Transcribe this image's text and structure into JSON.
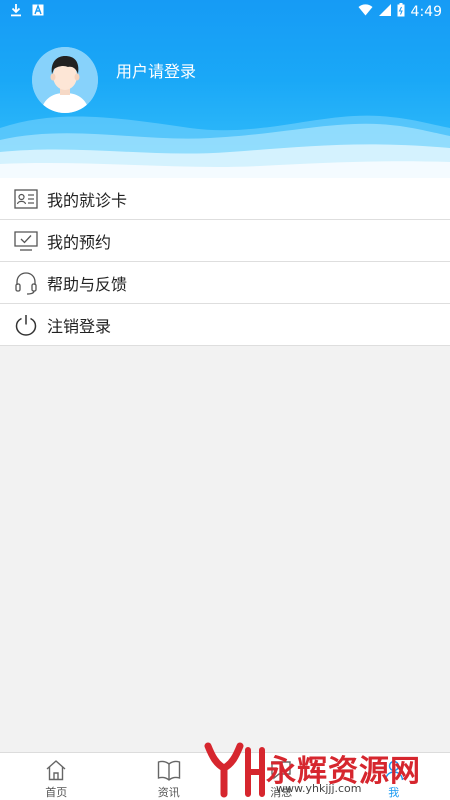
{
  "status_bar": {
    "time": "4:49",
    "icons": [
      "download-icon",
      "a-icon",
      "wifi-icon",
      "signal-icon",
      "battery-icon"
    ]
  },
  "profile": {
    "login_prompt": "用户请登录"
  },
  "menu": {
    "items": [
      {
        "label": "我的就诊卡",
        "icon": "id-card-icon"
      },
      {
        "label": "我的预约",
        "icon": "monitor-check-icon"
      },
      {
        "label": "帮助与反馈",
        "icon": "headset-icon"
      },
      {
        "label": "注销登录",
        "icon": "power-icon"
      }
    ]
  },
  "bottom_nav": {
    "items": [
      {
        "label": "首页",
        "icon": "home-icon"
      },
      {
        "label": "资讯",
        "icon": "book-icon"
      },
      {
        "label": "消息",
        "icon": "message-icon"
      },
      {
        "label": "我",
        "icon": "user-icon"
      }
    ],
    "active_index": 3
  },
  "watermark": {
    "text": "永辉资源网",
    "url": "www.yhkjjj.com"
  },
  "colors": {
    "header_blue": "#169bf5",
    "accent": "#1c9bf2",
    "watermark_red": "#d6262e"
  }
}
